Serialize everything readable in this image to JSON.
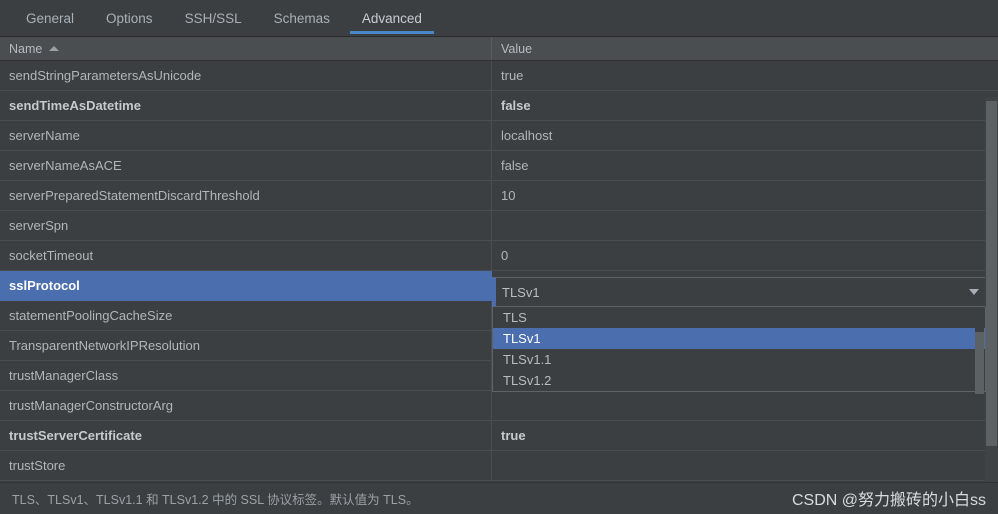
{
  "tabs": [
    {
      "label": "General",
      "active": false
    },
    {
      "label": "Options",
      "active": false
    },
    {
      "label": "SSH/SSL",
      "active": false
    },
    {
      "label": "Schemas",
      "active": false
    },
    {
      "label": "Advanced",
      "active": true
    }
  ],
  "table": {
    "columns": [
      {
        "label": "Name",
        "sort": "asc"
      },
      {
        "label": "Value",
        "sort": "none"
      }
    ],
    "rows": [
      {
        "name": "sendStringParametersAsUnicode",
        "value": "true",
        "bold": false,
        "selected": false
      },
      {
        "name": "sendTimeAsDatetime",
        "value": "false",
        "bold": true,
        "selected": false
      },
      {
        "name": "serverName",
        "value": "localhost",
        "bold": false,
        "selected": false
      },
      {
        "name": "serverNameAsACE",
        "value": "false",
        "bold": false,
        "selected": false
      },
      {
        "name": "serverPreparedStatementDiscardThreshold",
        "value": "10",
        "bold": false,
        "selected": false
      },
      {
        "name": "serverSpn",
        "value": "",
        "bold": false,
        "selected": false
      },
      {
        "name": "socketTimeout",
        "value": "0",
        "bold": false,
        "selected": false
      },
      {
        "name": "sslProtocol",
        "value": "",
        "bold": false,
        "selected": true
      },
      {
        "name": "statementPoolingCacheSize",
        "value": "",
        "bold": false,
        "selected": false
      },
      {
        "name": "TransparentNetworkIPResolution",
        "value": "",
        "bold": false,
        "selected": false
      },
      {
        "name": "trustManagerClass",
        "value": "",
        "bold": false,
        "selected": false
      },
      {
        "name": "trustManagerConstructorArg",
        "value": "",
        "bold": false,
        "selected": false
      },
      {
        "name": "trustServerCertificate",
        "value": "true",
        "bold": true,
        "selected": false
      },
      {
        "name": "trustStore",
        "value": "",
        "bold": false,
        "selected": false
      }
    ]
  },
  "editor": {
    "value": "TLSv1",
    "arrow_icon": "chevron-down-icon"
  },
  "dropdown": {
    "options": [
      {
        "label": "TLS",
        "selected": false
      },
      {
        "label": "TLSv1",
        "selected": true
      },
      {
        "label": "TLSv1.1",
        "selected": false
      },
      {
        "label": "TLSv1.2",
        "selected": false
      }
    ]
  },
  "statusbar": {
    "hint": "TLS、TLSv1、TLSv1.1 和 TLSv1.2 中的 SSL 协议标签。默认值为 TLS。"
  },
  "watermark": {
    "text": "CSDN @努力搬砖的小白ss"
  },
  "colors": {
    "background": "#3c3f41",
    "accent": "#4b6eaf",
    "tab_underline": "#4a88c7",
    "header_background": "#4a4e51",
    "text": "#b0b6bb"
  }
}
